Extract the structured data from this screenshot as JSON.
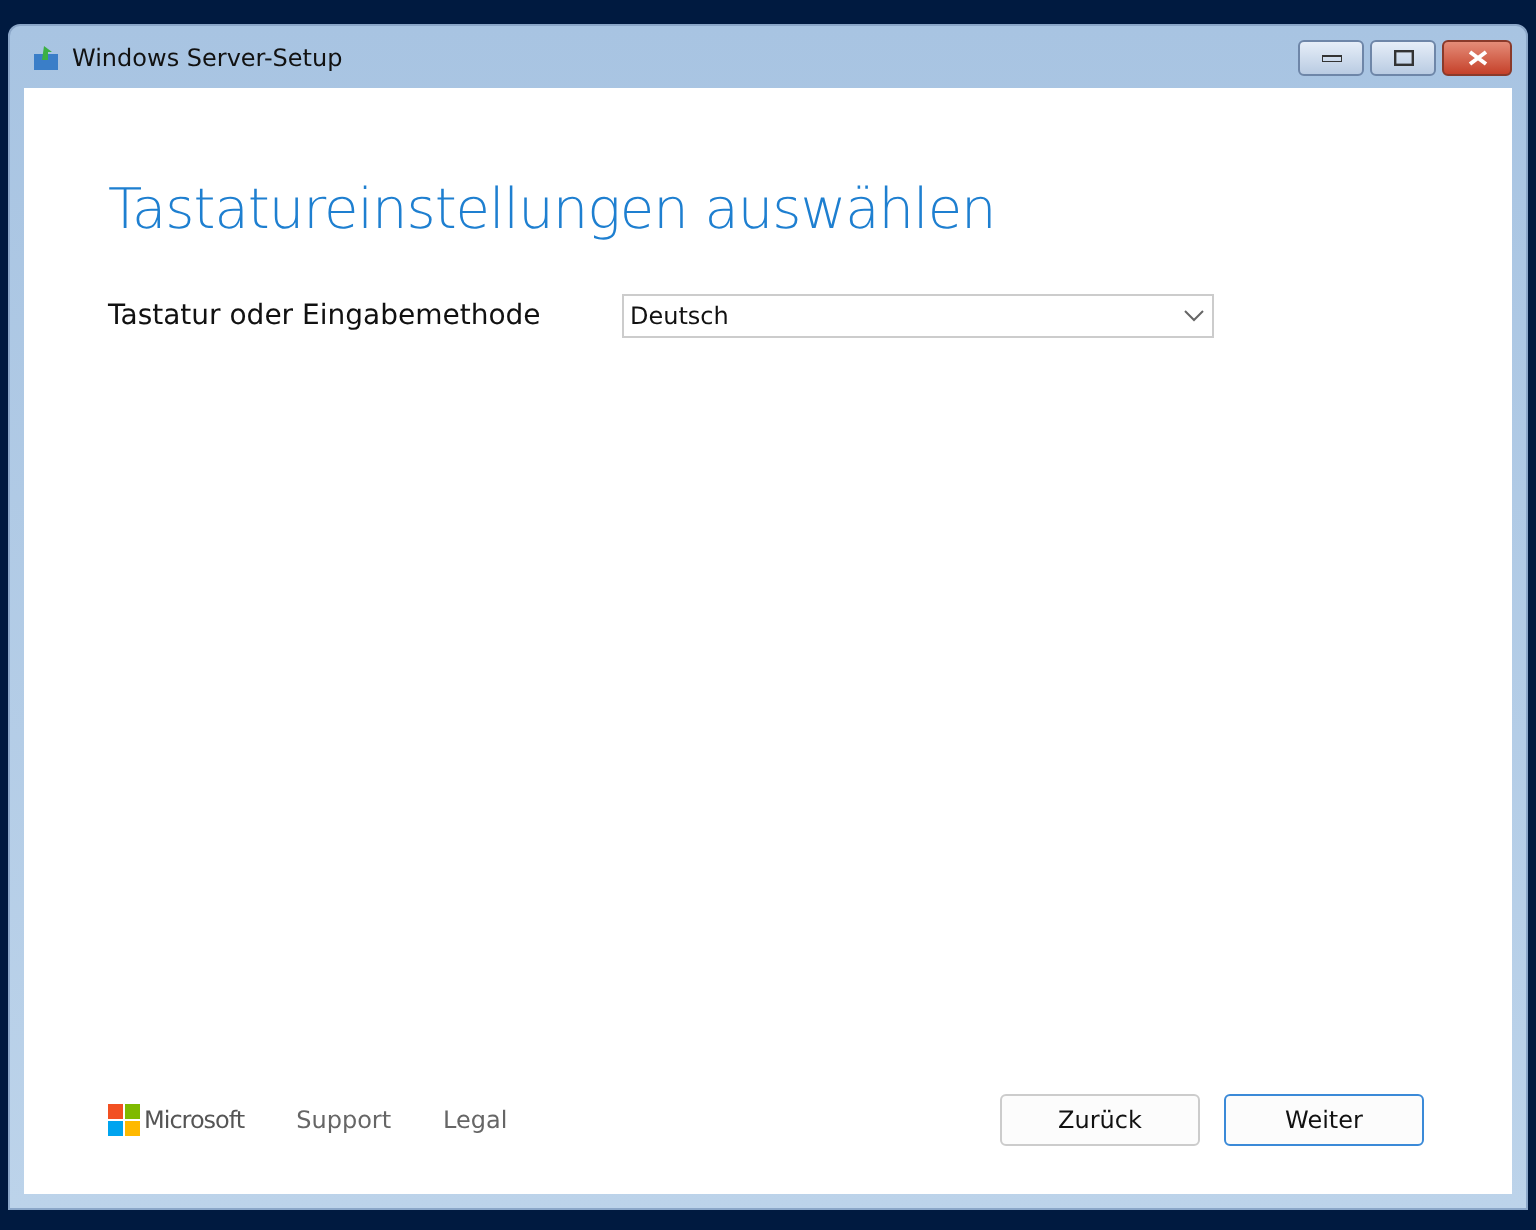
{
  "window": {
    "title": "Windows Server-Setup"
  },
  "heading": "Tastatureinstellungen auswählen",
  "keyboard": {
    "label": "Tastatur oder Eingabemethode",
    "value": "Deutsch"
  },
  "footer": {
    "brand": "Microsoft",
    "links": [
      "Support",
      "Legal"
    ]
  },
  "buttons": [
    {
      "label": "Zurück",
      "default": false
    },
    {
      "label": "Weiter",
      "default": true
    }
  ]
}
